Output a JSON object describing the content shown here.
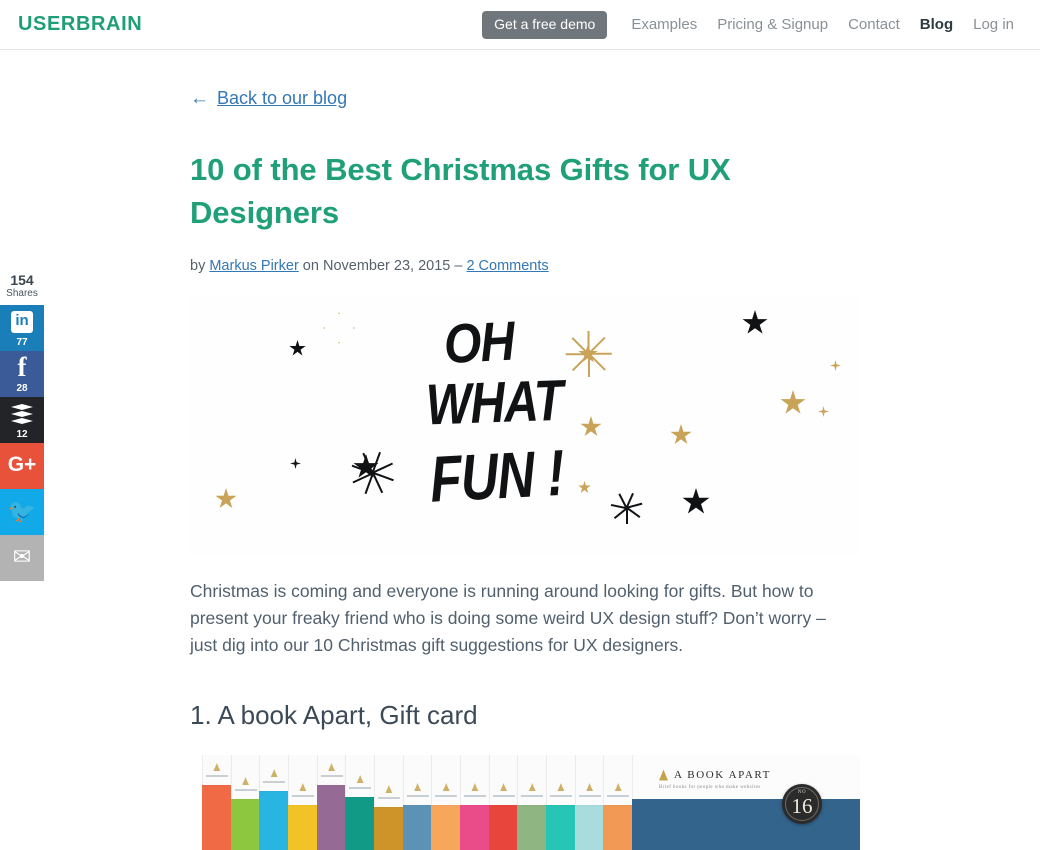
{
  "header": {
    "logo": "USERBRAIN",
    "demo_button": "Get a free demo",
    "nav": [
      {
        "label": "Examples",
        "active": false
      },
      {
        "label": "Pricing & Signup",
        "active": false
      },
      {
        "label": "Contact",
        "active": false
      },
      {
        "label": "Blog",
        "active": true
      },
      {
        "label": "Log in",
        "active": false
      }
    ]
  },
  "social": {
    "total_count": "154",
    "total_label": "Shares",
    "items": [
      {
        "network": "linkedin",
        "icon": "linkedin-icon",
        "count": "77",
        "color": "#1a7fb8"
      },
      {
        "network": "facebook",
        "icon": "facebook-icon",
        "count": "28",
        "color": "#3a5a98"
      },
      {
        "network": "buffer",
        "icon": "buffer-icon",
        "count": "12",
        "color": "#222428"
      },
      {
        "network": "googleplus",
        "icon": "google-plus-icon",
        "count": "",
        "color": "#e8513a",
        "glyph": "G+"
      },
      {
        "network": "twitter",
        "icon": "twitter-icon",
        "count": "",
        "color": "#12a9e8",
        "glyph": "🐦"
      },
      {
        "network": "email",
        "icon": "email-icon",
        "count": "",
        "color": "#b3b3b3",
        "glyph": "✉"
      }
    ]
  },
  "post": {
    "back_link": "Back to our blog",
    "back_arrow": "←",
    "title": "10 of the Best Christmas Gifts for UX Designers",
    "byline_prefix": "by ",
    "author": "Markus Pirker",
    "byline_mid": " on ",
    "date": "November 23, 2015",
    "byline_sep": " – ",
    "comments": "2 Comments",
    "hero_alt": "Oh What Fun hand lettered holiday illustration with black and gold stars",
    "hero_lettering": {
      "line1": "OH",
      "line2": "WHAT",
      "line3": "FUN !"
    },
    "paragraph": "Christmas is coming and everyone is running around looking for gifts. But how to present your freaky friend who is doing some weird UX design stuff? Don’t worry – just dig into our 10 Christmas gift suggestions for UX designers.",
    "section_1_heading": "1. A book Apart, Gift card"
  },
  "book_image": {
    "brand": "A BOOK APART",
    "tagline": "Brief books for people who make websites",
    "badge_prefix": "NO",
    "badge_number": "16",
    "spine_colors": [
      "#ef6a45",
      "#8dc63f",
      "#28b5e1",
      "#f2c327",
      "#956b96",
      "#119a86",
      "#cf9429",
      "#5b92b5",
      "#f6a75c",
      "#ea4c89",
      "#e8453c",
      "#8fb583",
      "#27c5b6",
      "#a9dcdd",
      "#f29a55"
    ],
    "wide_cover_color": "#33648c"
  },
  "theme": {
    "brand_green": "#20a079",
    "link_blue": "#3477b5",
    "text_slate": "#51606e",
    "nav_gray": "#8a9196"
  }
}
